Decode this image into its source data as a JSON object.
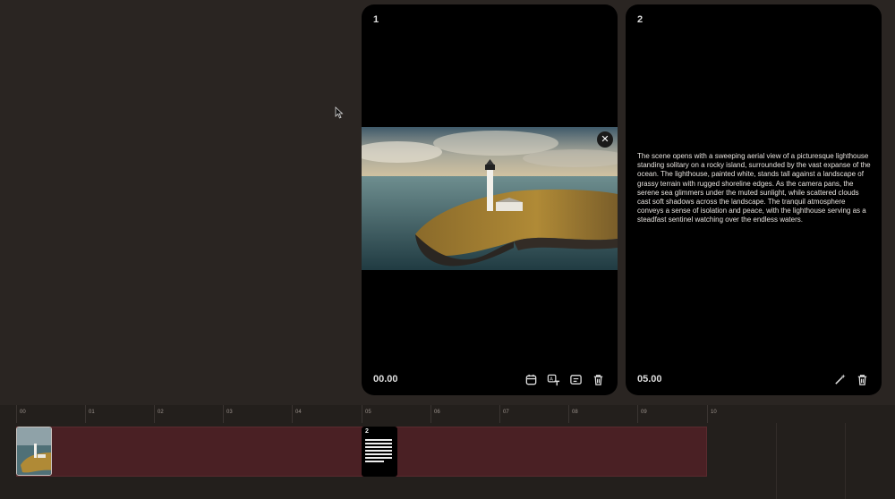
{
  "scenes": [
    {
      "number": "1",
      "time": "00.00",
      "image_alt": "Aerial view of a lighthouse on a rocky island",
      "close_icon": "close-icon",
      "actions": [
        "calendar-icon",
        "translate-icon",
        "caption-icon",
        "trash-icon"
      ]
    },
    {
      "number": "2",
      "time": "05.00",
      "description": "The scene opens with a sweeping aerial view of a picturesque lighthouse standing solitary on a rocky island, surrounded by the vast expanse of the ocean. The lighthouse, painted white, stands tall against a landscape of grassy terrain with rugged shoreline edges. As the camera pans, the serene sea glimmers under the muted sunlight, while scattered clouds cast soft shadows across the landscape. The tranquil atmosphere conveys a sense of isolation and peace, with the lighthouse serving as a steadfast sentinel watching over the endless waters.",
      "actions": [
        "magic-wand-icon",
        "trash-icon"
      ]
    }
  ],
  "timeline": {
    "ticks": [
      "00",
      "01",
      "02",
      "03",
      "04",
      "05",
      "06",
      "07",
      "08",
      "09",
      "10"
    ],
    "text_clip_number": "2"
  },
  "colors": {
    "background": "#2a2522",
    "card": "#000000",
    "track": "#4a2024"
  }
}
